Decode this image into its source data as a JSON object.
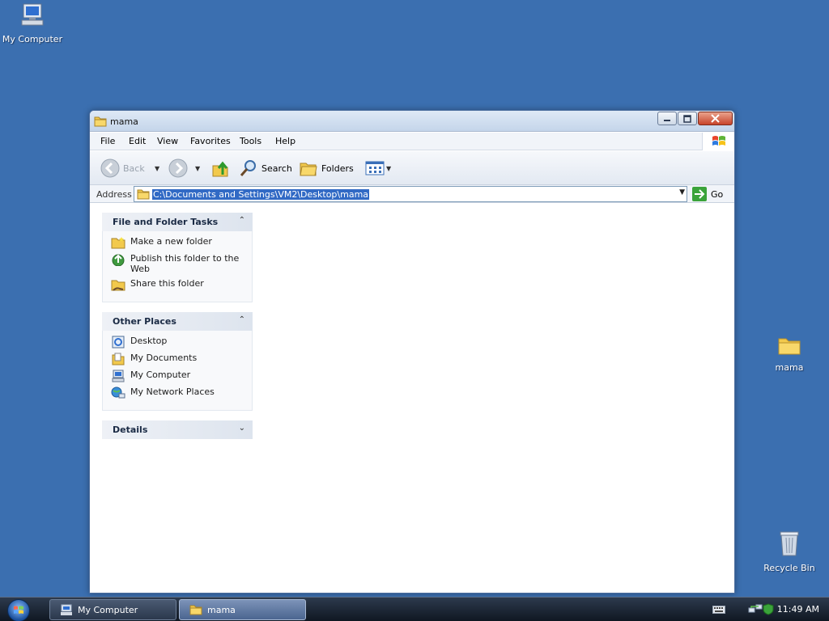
{
  "desktop": {
    "icons": [
      {
        "label": "My Computer",
        "icon": "my-computer-icon"
      },
      {
        "label": "mama",
        "icon": "folder-icon"
      },
      {
        "label": "Recycle Bin",
        "icon": "recycle-bin-icon"
      }
    ]
  },
  "window": {
    "title": "mama",
    "menu": [
      "File",
      "Edit",
      "View",
      "Favorites",
      "Tools",
      "Help"
    ],
    "toolbar": {
      "back_label": "Back",
      "search_label": "Search",
      "folders_label": "Folders"
    },
    "address": {
      "label": "Address",
      "value": "C:\\Documents and Settings\\VM2\\Desktop\\mama",
      "go_label": "Go"
    },
    "taskpane": {
      "file_tasks": {
        "title": "File and Folder Tasks",
        "items": [
          "Make a new folder",
          "Publish this folder to the Web",
          "Share this folder"
        ]
      },
      "other_places": {
        "title": "Other Places",
        "items": [
          "Desktop",
          "My Documents",
          "My Computer",
          "My Network Places"
        ]
      },
      "details": {
        "title": "Details"
      }
    }
  },
  "taskbar": {
    "buttons": [
      {
        "label": "My Computer",
        "active": false
      },
      {
        "label": "mama",
        "active": true
      }
    ],
    "clock": "11:49 AM"
  },
  "colors": {
    "desktop": "#3b6fb0",
    "selection": "#316ac5"
  }
}
